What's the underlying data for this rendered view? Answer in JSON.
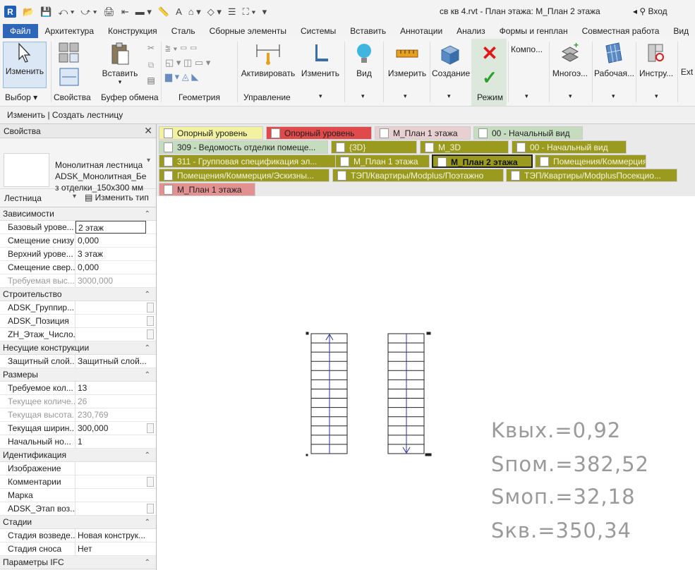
{
  "app": {
    "logo": "R",
    "title": "св кв 4.rvt - План этажа: М_План 2 этажа",
    "sign_in": "Вход"
  },
  "quick_access": [
    "📂",
    "💾",
    "⤺ ▾",
    "⤻ ▾",
    "🖨",
    "⇤",
    "▬ ▾",
    "📏",
    "A",
    "⌂ ▾",
    "◇ ▾",
    "☰",
    "⛶ ▾",
    "▾"
  ],
  "menu": [
    "Файл",
    "Архитектура",
    "Конструкция",
    "Сталь",
    "Сборные элементы",
    "Системы",
    "Вставить",
    "Аннотации",
    "Анализ",
    "Формы и генплан",
    "Совместная работа",
    "Вид"
  ],
  "ribbon": {
    "buttons": {
      "modify": "Изменить",
      "paste": "Вставить",
      "activate": "Активировать",
      "modify2": "Изменить",
      "view": "Вид",
      "measure": "Измерить",
      "create": "Создание",
      "component": "Компо...",
      "multi": "Многоэ...",
      "work": "Рабочая...",
      "tools": "Инстру...",
      "ext": "Ext"
    },
    "groups": {
      "select": "Выбор ▾",
      "properties": "Свойства",
      "clipboard": "Буфер обмена",
      "geometry": "Геометрия",
      "control": "Управление",
      "mode": "Режим"
    }
  },
  "context_bar": "Изменить | Создать лестницу",
  "properties": {
    "header": "Свойства",
    "type_name": "Монолитная лестница ADSK_Монолитная_Бе з отделки_150x300 мм",
    "category": "Лестница",
    "edit_type": "Изменить тип",
    "sections": [
      {
        "title": "Зависимости",
        "rows": [
          {
            "k": "Базовый урове...",
            "v": "2 этаж"
          },
          {
            "k": "Смещение снизу",
            "v": "0,000"
          },
          {
            "k": "Верхний урове...",
            "v": "3 этаж"
          },
          {
            "k": "Смещение свер...",
            "v": "0,000"
          },
          {
            "k": "Требуемая выс...",
            "v": "3000,000"
          }
        ]
      },
      {
        "title": "Строительство",
        "rows": [
          {
            "k": "ADSK_Группир...",
            "v": ""
          },
          {
            "k": "ADSK_Позиция",
            "v": ""
          },
          {
            "k": "ZH_Этаж_Число...",
            "v": ""
          }
        ]
      },
      {
        "title": "Несущие конструкции",
        "rows": [
          {
            "k": "Защитный слой...",
            "v": "Защитный слой..."
          }
        ]
      },
      {
        "title": "Размеры",
        "rows": [
          {
            "k": "Требуемое кол...",
            "v": "13"
          },
          {
            "k": "Текущее количе...",
            "v": "26"
          },
          {
            "k": "Текущая высота...",
            "v": "230,769"
          },
          {
            "k": "Текущая ширин...",
            "v": "300,000"
          },
          {
            "k": "Начальный но...",
            "v": "1"
          }
        ]
      },
      {
        "title": "Идентификация",
        "rows": [
          {
            "k": "Изображение",
            "v": ""
          },
          {
            "k": "Комментарии",
            "v": ""
          },
          {
            "k": "Марка",
            "v": ""
          },
          {
            "k": "ADSK_Этап воз...",
            "v": ""
          }
        ]
      },
      {
        "title": "Стадии",
        "rows": [
          {
            "k": "Стадия возведе...",
            "v": "Новая конструк..."
          },
          {
            "k": "Стадия сноса",
            "v": "Нет"
          }
        ]
      },
      {
        "title": "Параметры IFC",
        "rows": []
      }
    ]
  },
  "view_tabs": [
    {
      "label": "Опорный уровень",
      "color": "#f2f2a0"
    },
    {
      "label": "Опорный уровень",
      "color": "#e04a4a"
    },
    {
      "label": "М_План 1 этажа",
      "color": "#e8d0d0"
    },
    {
      "label": "00 - Начальный вид",
      "color": "#c6dcbf"
    },
    {
      "label": "309 - Ведомость отделки помеще...",
      "color": "#c6dcbf"
    },
    {
      "label": "{3D}",
      "color": "#9a9a1e"
    },
    {
      "label": "М_3D",
      "color": "#9a9a1e"
    },
    {
      "label": "00 - Начальный вид",
      "color": "#9a9a1e"
    },
    {
      "label": "311 - Групповая спецификация эл...",
      "color": "#9a9a1e"
    },
    {
      "label": "М_План 1 этажа",
      "color": "#9a9a1e"
    },
    {
      "label": "М_План 2 этажа",
      "color": "#9a9a1e"
    },
    {
      "label": "Помещения/Коммерция",
      "color": "#9a9a1e"
    },
    {
      "label": "Помещения/Коммерция/Эскизны...",
      "color": "#9a9a1e"
    },
    {
      "label": "ТЭП/Квартиры/Modplus/Поэтажно",
      "color": "#9a9a1e"
    },
    {
      "label": "ТЭП/Квартиры/ModplusПосекцио...",
      "color": "#9a9a1e"
    },
    {
      "label": "М_План 1 этажа",
      "color": "#e29090"
    }
  ],
  "annotations": [
    "Kвых.=0,92",
    "Sпом.=382,52",
    "Sмоп.=32,18",
    "Sкв.=350,34"
  ]
}
